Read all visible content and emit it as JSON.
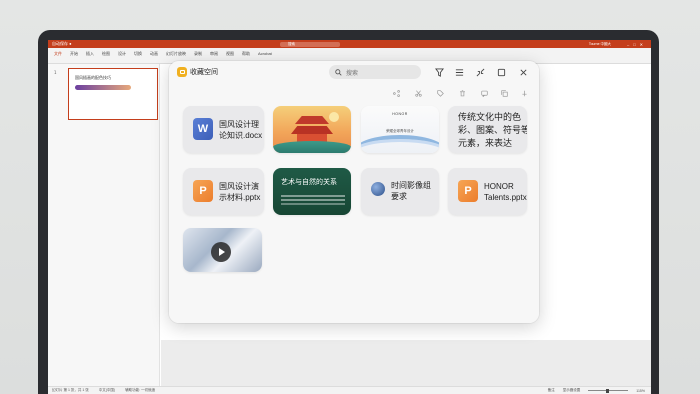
{
  "ppt": {
    "titlebar_left": "自动保存 ●",
    "doc_name": "",
    "search_placeholder": "搜索",
    "titlebar_right": "Tourne 中國大",
    "ribbon_tabs": [
      "文件",
      "开始",
      "插入",
      "绘图",
      "设计",
      "切换",
      "动画",
      "幻灯片放映",
      "录制",
      "审阅",
      "视图",
      "帮助",
      "Acrobat"
    ],
    "slide_number": "1",
    "slide_title": "国风插画的配色技巧",
    "status_left": "幻灯片 第 1 张，共 1 张",
    "status_lang": "中文(中国)",
    "status_access": "辅助功能: 一切就绪",
    "status_notes": "备注",
    "status_display": "显示器设置",
    "zoom": "115%"
  },
  "panel": {
    "title": "收藏空间",
    "search_placeholder": "搜索",
    "cards": [
      {
        "type": "docx",
        "icon_letter": "W",
        "name": "国风设计理\n论知识.docx"
      },
      {
        "type": "image",
        "name": "temple"
      },
      {
        "type": "image",
        "name": "honor",
        "logo": "HONOR",
        "sub": "荣耀全球青年设计"
      },
      {
        "type": "text",
        "text": "传统文化中的色彩、图案、符号等元素，来表达"
      },
      {
        "type": "pptx",
        "icon_letter": "P",
        "name": "国风设计演\n示材料.pptx"
      },
      {
        "type": "image",
        "name": "green",
        "title": "艺术与自然的关系"
      },
      {
        "type": "web",
        "name": "时间影像组\n要求"
      },
      {
        "type": "pptx",
        "icon_letter": "P",
        "name": "HONOR\nTalents.pptx"
      },
      {
        "type": "video",
        "name": "video"
      }
    ]
  },
  "colors": {
    "ppt_accent": "#c43e1c",
    "panel_bg": "#f7f7f7",
    "card_bg": "#e9e9eb",
    "word_blue": "#3d5fb8",
    "ppt_orange": "#ec7d2c",
    "green_card": "#1f5a46"
  }
}
